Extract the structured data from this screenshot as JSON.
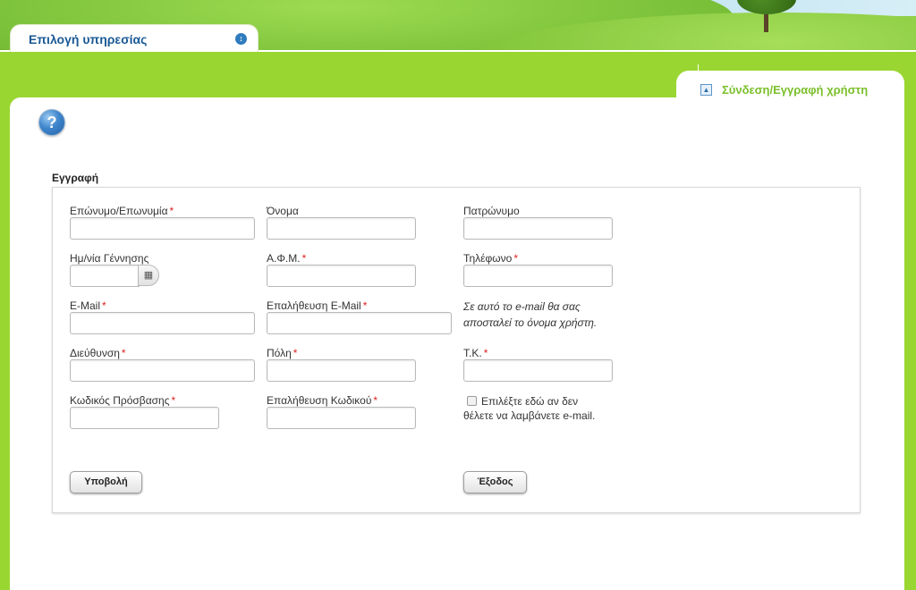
{
  "header": {
    "service_tab_label": "Επιλογή υπηρεσίας",
    "login_tab_label": "Σύνδεση/Εγγραφή χρήστη"
  },
  "help": {
    "icon_glyph": "?"
  },
  "form": {
    "title": "Εγγραφή",
    "fields": {
      "surname": {
        "label": "Επώνυμο/Επωνυμία",
        "required_mark": "*",
        "value": ""
      },
      "first_name": {
        "label": "Όνομα",
        "value": ""
      },
      "fathers_name": {
        "label": "Πατρώνυμο",
        "value": ""
      },
      "birth_date": {
        "label": "Ημ/νία Γέννησης",
        "value": ""
      },
      "afm": {
        "label": "Α.Φ.Μ.",
        "required_mark": "*",
        "value": ""
      },
      "phone": {
        "label": "Τηλέφωνο",
        "required_mark": "*",
        "value": ""
      },
      "email": {
        "label": "E-Mail",
        "required_mark": "*",
        "value": ""
      },
      "email_confirm": {
        "label": "Επαλήθευση E-Mail",
        "required_mark": "*",
        "value": ""
      },
      "address": {
        "label": "Διεύθυνση",
        "required_mark": "*",
        "value": ""
      },
      "city": {
        "label": "Πόλη",
        "required_mark": "*",
        "value": ""
      },
      "postal_code": {
        "label": "Τ.Κ.",
        "required_mark": "*",
        "value": ""
      },
      "password": {
        "label": "Κωδικός Πρόσβασης",
        "required_mark": "*",
        "value": ""
      },
      "password_confirm": {
        "label": "Επαλήθευση Κωδικού",
        "required_mark": "*",
        "value": ""
      }
    },
    "email_note": "Σε αυτό το e-mail θα σας αποσταλεί το όνομα χρήστη.",
    "opt_out_label": "Επιλέξτε εδώ αν δεν θέλετε να λαμβάνετε e-mail.",
    "opt_out_checked": false,
    "submit_label": "Υποβολή",
    "exit_label": "Έξοδος"
  },
  "colors": {
    "background": "#9ad631",
    "service_tab_text": "#1a5a95",
    "login_tab_text": "#7bbf2a",
    "required": "#dd2222"
  },
  "icons": {
    "calendar": "calendar-icon",
    "help": "help-icon",
    "collapse": "collapse-icon",
    "expand": "expand-icon"
  }
}
